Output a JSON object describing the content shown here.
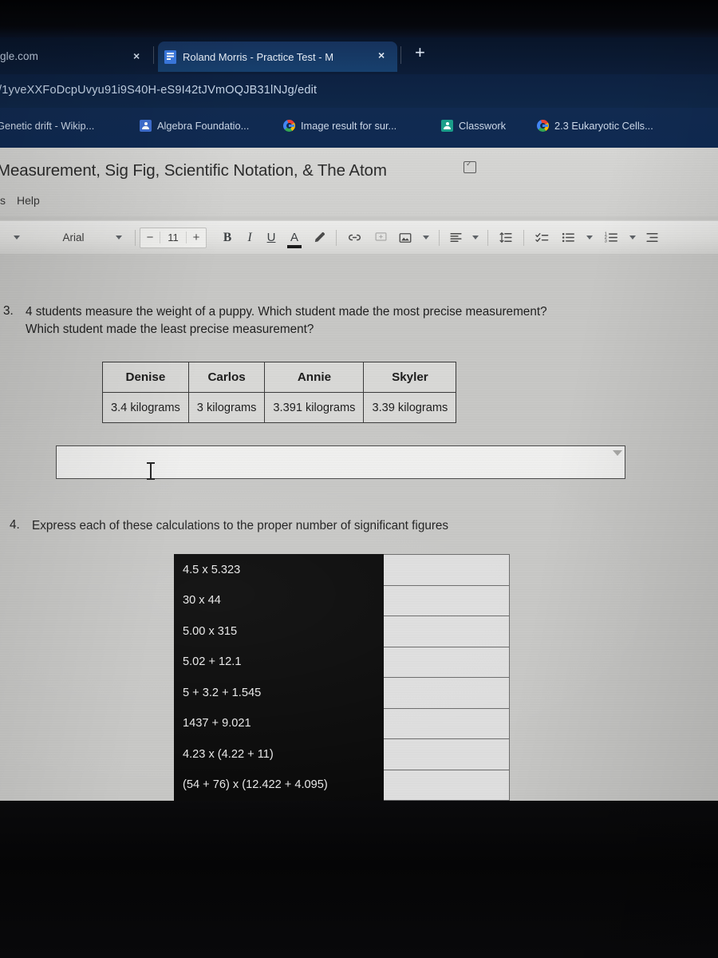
{
  "browser": {
    "previous_tab_label": "gle.com",
    "previous_tab_close": "×",
    "active_tab_title": "Roland Morris - Practice Test - M",
    "active_tab_close": "×",
    "new_tab_label": "+",
    "url": "/1yveXXFoDcpUvyu91i9S40H-eS9I42tJVmOQJB31lNJg/edit",
    "bookmarks": [
      {
        "label": "Genetic drift - Wikip...",
        "icon": "none"
      },
      {
        "label": "Algebra Foundatio...",
        "icon": "classroom-blue-icon"
      },
      {
        "label": "Image result for sur...",
        "icon": "google-icon"
      },
      {
        "label": "Classwork",
        "icon": "classroom-teal-icon"
      },
      {
        "label": "2.3 Eukaryotic Cells...",
        "icon": "google-icon"
      }
    ]
  },
  "docs": {
    "title": "Measurement, Sig Fig, Scientific Notation, & The Atom",
    "menu": [
      "s",
      "Help"
    ],
    "toolbar": {
      "undo_caret": "▾",
      "font_name": "Arial",
      "font_decrease": "−",
      "font_size": "11",
      "font_increase": "+",
      "bold": "B",
      "italic": "I",
      "underline": "U",
      "text_color": "A",
      "highlight": "highlight-pen-icon",
      "link": "link-icon",
      "comment": "add-comment-icon",
      "image": "insert-image-icon",
      "align": "align-left-icon",
      "line_spacing": "line-spacing-icon",
      "checklist": "checklist-icon",
      "bulleted_list": "bulleted-list-icon",
      "numbered_list": "numbered-list-icon"
    }
  },
  "document": {
    "question3": {
      "number": "3.",
      "line1": "4 students measure the weight of a puppy.  Which student made the most precise measurement?",
      "line2": "Which student made the least precise measurement?",
      "table": {
        "headers": [
          "Denise",
          "Carlos",
          "Annie",
          "Skyler"
        ],
        "values": [
          "3.4 kilograms",
          "3 kilograms",
          "3.391 kilograms",
          "3.39 kilograms"
        ]
      },
      "answer_value": ""
    },
    "question4": {
      "number": "4.",
      "prompt": "Express each of these calculations to the proper number of significant figures",
      "rows": [
        {
          "expression": "4.5 x 5.323",
          "answer": ""
        },
        {
          "expression": "30 x 44",
          "answer": ""
        },
        {
          "expression": "5.00 x 315",
          "answer": ""
        },
        {
          "expression": "5.02 + 12.1",
          "answer": ""
        },
        {
          "expression": "5 + 3.2 + 1.545",
          "answer": ""
        },
        {
          "expression": "1437 + 9.021",
          "answer": ""
        },
        {
          "expression": "4.23 x (4.22 + 11)",
          "answer": ""
        },
        {
          "expression": "(54 + 76) x (12.422 + 4.095)",
          "answer": ""
        }
      ]
    }
  },
  "colors": {
    "chrome_blue": "#10223f",
    "tab_active": "#17406e",
    "docs_gray": "#c9c9c7",
    "toolbar_gray": "#e3e3e1",
    "expr_cell_bg": "#0a0a0a",
    "blank_cell_bg": "#dedede"
  }
}
